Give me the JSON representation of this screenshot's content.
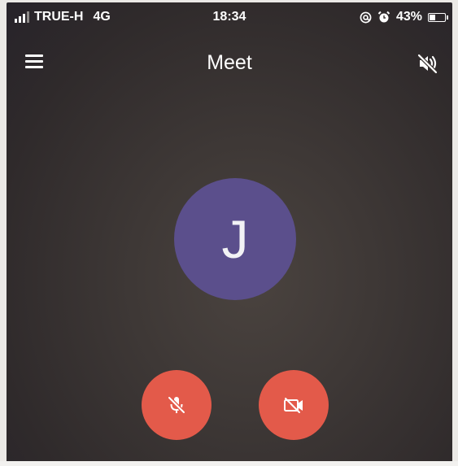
{
  "status_bar": {
    "carrier": "TRUE-H",
    "network": "4G",
    "time": "18:34",
    "battery": "43%",
    "battery_level": 0.43,
    "icons": [
      "signal-icon",
      "at-icon",
      "alarm-icon",
      "battery-icon"
    ]
  },
  "app_bar": {
    "title": "Meet",
    "menu_icon": "menu-icon",
    "speaker_icon": "speaker-muted-icon"
  },
  "participant": {
    "initial": "J",
    "avatar_color": "#5b4f8c"
  },
  "controls": {
    "mic_icon": "mic-off-icon",
    "camera_icon": "camera-off-icon",
    "button_color": "#e35a4a"
  }
}
